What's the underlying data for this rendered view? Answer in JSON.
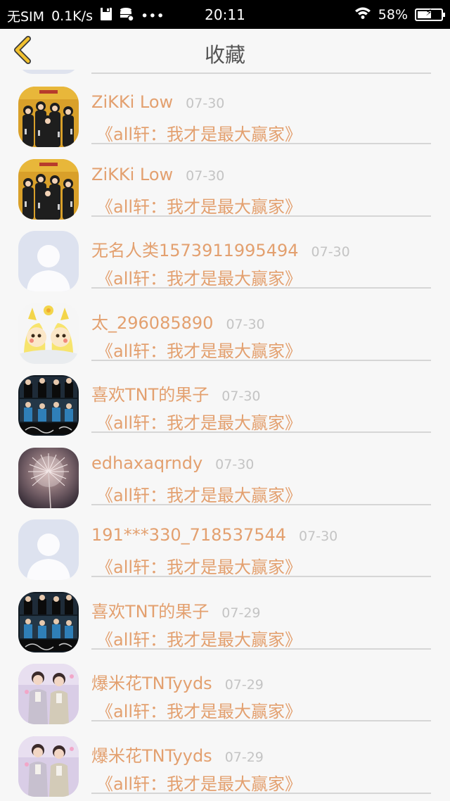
{
  "status_bar": {
    "carrier": "无SIM",
    "speed": "0.1K/s",
    "more": "•••",
    "time": "20:11",
    "battery": "58%",
    "battery_level": 0.58
  },
  "header": {
    "title": "收藏",
    "back_icon": "chevron-left-icon",
    "accent_color": "#f2c12e"
  },
  "colors": {
    "name_text": "#e3a06f",
    "date_text": "#c4c4c4",
    "background": "#f7f7f7"
  },
  "items": [
    {
      "name": "ZiKKi Low",
      "date": "07-30",
      "comment": "《all轩：我才是最大赢家》",
      "avatar": "group-photo-yellow"
    },
    {
      "name": "ZiKKi Low",
      "date": "07-30",
      "comment": "《all轩：我才是最大赢家》",
      "avatar": "group-photo-yellow"
    },
    {
      "name": "无名人类1573911995494",
      "date": "07-30",
      "comment": "《all轩：我才是最大赢家》",
      "avatar": "default-avatar"
    },
    {
      "name": "太_296085890",
      "date": "07-30",
      "comment": "《all轩：我才是最大赢家》",
      "avatar": "pikachu-anime"
    },
    {
      "name": "喜欢TNT的果子",
      "date": "07-30",
      "comment": "《all轩：我才是最大赢家》",
      "avatar": "group-collage-dark"
    },
    {
      "name": "edhaxaqrndy",
      "date": "07-30",
      "comment": "《all轩：我才是最大赢家》",
      "avatar": "dandelion"
    },
    {
      "name": "191***330_718537544",
      "date": "07-30",
      "comment": "《all轩：我才是最大赢家》",
      "avatar": "default-avatar"
    },
    {
      "name": "喜欢TNT的果子",
      "date": "07-29",
      "comment": "《all轩：我才是最大赢家》",
      "avatar": "group-collage-dark"
    },
    {
      "name": "爆米花TNTyyds",
      "date": "07-29",
      "comment": "《all轩：我才是最大赢家》",
      "avatar": "duo-photo-pastel"
    },
    {
      "name": "爆米花TNTyyds",
      "date": "07-29",
      "comment": "《all轩：我才是最大赢家》",
      "avatar": "duo-photo-pastel"
    }
  ]
}
